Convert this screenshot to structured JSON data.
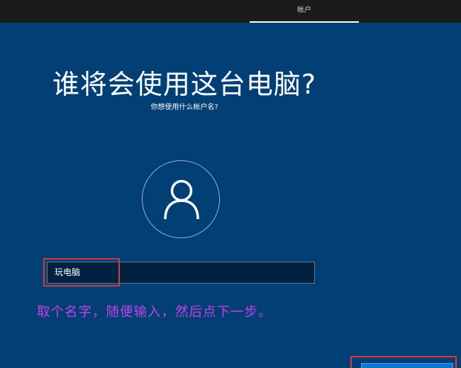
{
  "topbar": {
    "active_tab": "帐户"
  },
  "main": {
    "title": "谁将会使用这台电脑?",
    "subtitle": "你想使用什么帐户名?",
    "avatar_icon": "user-icon"
  },
  "account_form": {
    "name_value": "玩电脑"
  },
  "annotation": {
    "instruction": "取个名字，随便输入，然后点下一步。",
    "highlight_color": "#d63b3b",
    "text_color": "#c242e8"
  },
  "colors": {
    "background": "#013f74",
    "topbar": "#1b1b1b",
    "button": "#0b79d0"
  }
}
